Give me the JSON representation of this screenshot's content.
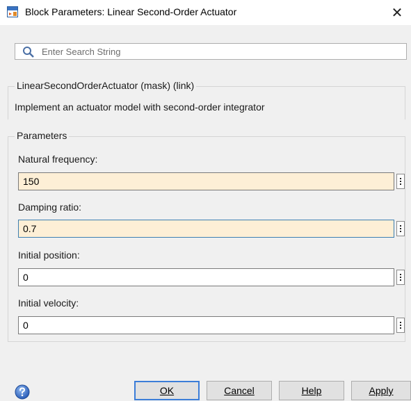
{
  "window": {
    "title": "Block Parameters: Linear Second-Order Actuator",
    "close_glyph": "✕"
  },
  "search": {
    "placeholder": "Enter Search String",
    "value": ""
  },
  "mask": {
    "header": "LinearSecondOrderActuator (mask) (link)",
    "description": "Implement an actuator model with second-order integrator"
  },
  "parameters": {
    "group_label": "Parameters",
    "natural_frequency": {
      "label": "Natural frequency:",
      "value": "150"
    },
    "damping_ratio": {
      "label": "Damping ratio:",
      "value": "0.7"
    },
    "initial_position": {
      "label": "Initial position:",
      "value": "0"
    },
    "initial_velocity": {
      "label": "Initial velocity:",
      "value": "0"
    }
  },
  "buttons": {
    "ok": "OK",
    "cancel": "Cancel",
    "help": "Help",
    "apply": "Apply"
  },
  "colors": {
    "accent": "#3b7dd8",
    "tuned_field_bg": "#fdefd6",
    "dialog_bg": "#f0f0f0"
  },
  "icons": {
    "app": "simulink-block-icon",
    "search": "search-icon",
    "help": "help-circle-icon",
    "field_menu": "vertical-dots-icon"
  }
}
